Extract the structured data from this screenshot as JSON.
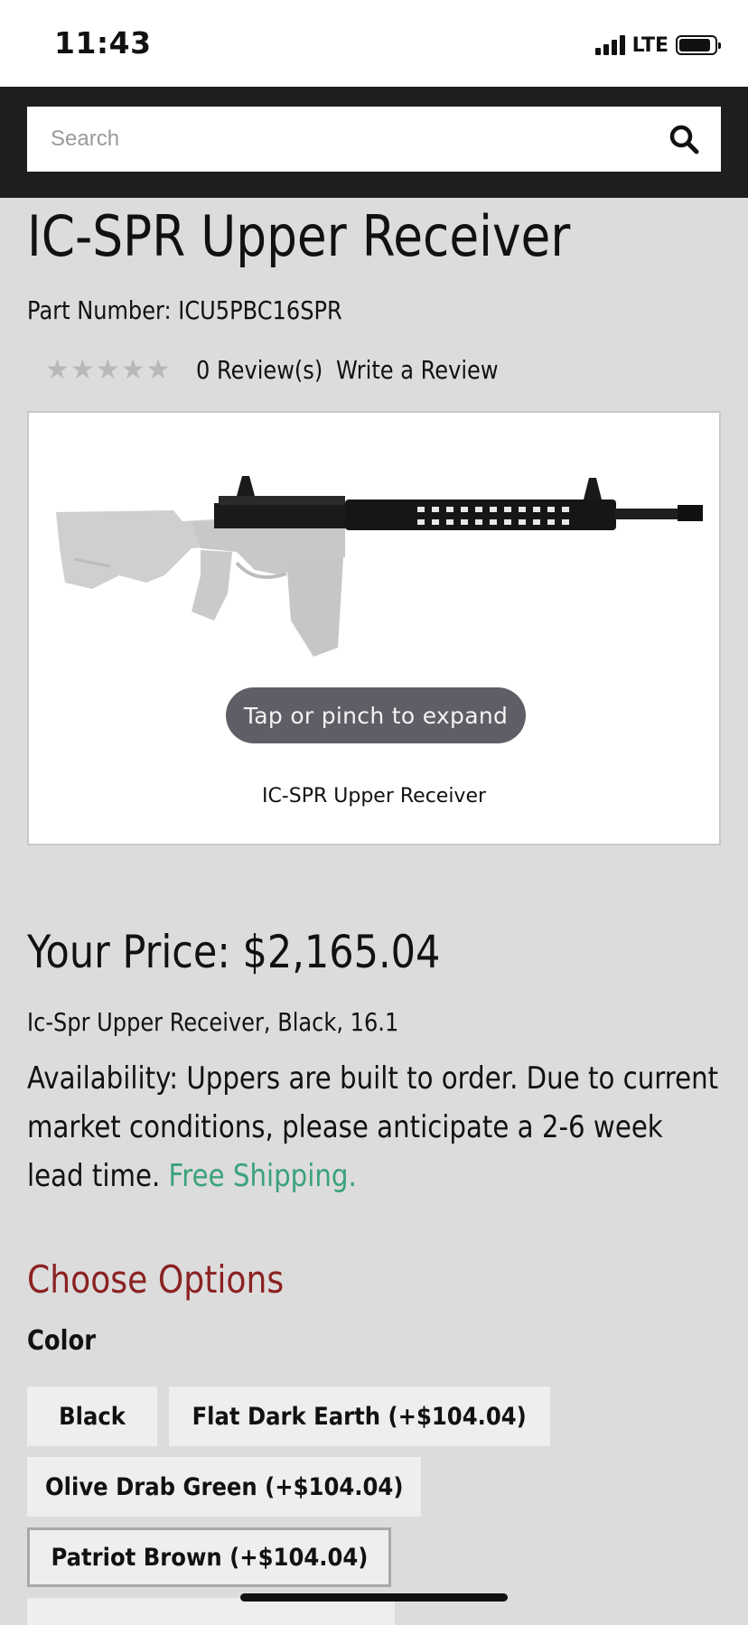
{
  "status_bar": {
    "time": "11:43",
    "network": "LTE",
    "battery_level": 0.9
  },
  "search": {
    "placeholder": "Search"
  },
  "product": {
    "title": "IC-SPR Upper Receiver",
    "part_number": "Part Number: ICU5PBC16SPR",
    "rating": 0,
    "review_count": "0 Review(s)",
    "write_review": "Write a Review",
    "image_hint": "Tap or pinch to expand",
    "image_caption": "IC-SPR Upper Receiver",
    "price": "Your Price:  $2,165.04",
    "short_description": "Ic-Spr Upper Receiver, Black, 16.1",
    "availability": "Availability: Uppers are built to order. Due to current market conditions, please anticipate a 2-6 week lead time.",
    "free_shipping": "Free Shipping."
  },
  "options": {
    "title": "Choose Options",
    "color_label": "Color",
    "colors": [
      {
        "label": "Black"
      },
      {
        "label": "Flat Dark Earth (+$104.04)"
      },
      {
        "label": "Olive Drab Green (+$104.04)"
      },
      {
        "label": "Patriot Brown (+$104.04)",
        "selected": true
      }
    ]
  },
  "colors": {
    "accent_red": "#8b2222",
    "accent_green": "#3aa27a",
    "header_bg": "#1e1e1e",
    "page_bg": "#dcdcdc"
  }
}
